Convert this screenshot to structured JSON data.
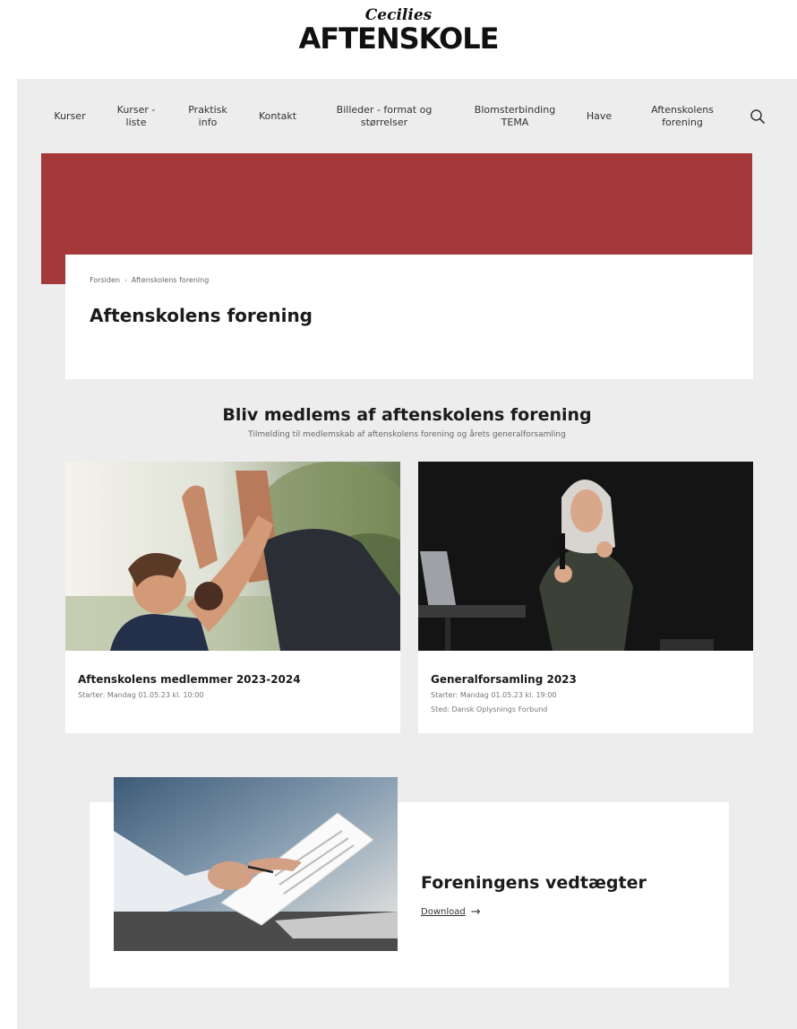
{
  "logo": {
    "top": "Cecilies",
    "main": "AFTENSKOLE"
  },
  "nav": {
    "items": [
      {
        "label": "Kurser"
      },
      {
        "label": "Kurser -\nliste"
      },
      {
        "label": "Praktisk\ninfo"
      },
      {
        "label": "Kontakt"
      },
      {
        "label": "Billeder - format og\nstørrelser"
      },
      {
        "label": "Blomsterbinding\nTEMA"
      },
      {
        "label": "Have"
      },
      {
        "label": "Aftenskolens\nforening"
      }
    ],
    "search_icon": "search-icon"
  },
  "colors": {
    "hero": "#a53838",
    "frame": "#ededed"
  },
  "breadcrumb": {
    "home": "Forsiden",
    "separator": "›",
    "current": "Aftenskolens forening"
  },
  "page_title": "Aftenskolens forening",
  "section": {
    "title": "Bliv medlems af aftenskolens forening",
    "subtitle": "Tilmelding til medlemskab af aftenskolens forening og årets generalforsamling"
  },
  "cards": [
    {
      "title": "Aftenskolens medlemmer 2023-2024",
      "meta1": "Starter: Mandag 01.05.23 kl. 10:00"
    },
    {
      "title": "Generalforsamling 2023",
      "meta1": "Starter: Mandag 01.05.23 kl. 19:00",
      "meta2": "Sted: Dansk Oplysnings Forbund"
    }
  ],
  "download": {
    "title": "Foreningens vedtægter",
    "link_label": "Download",
    "arrow": "→"
  }
}
